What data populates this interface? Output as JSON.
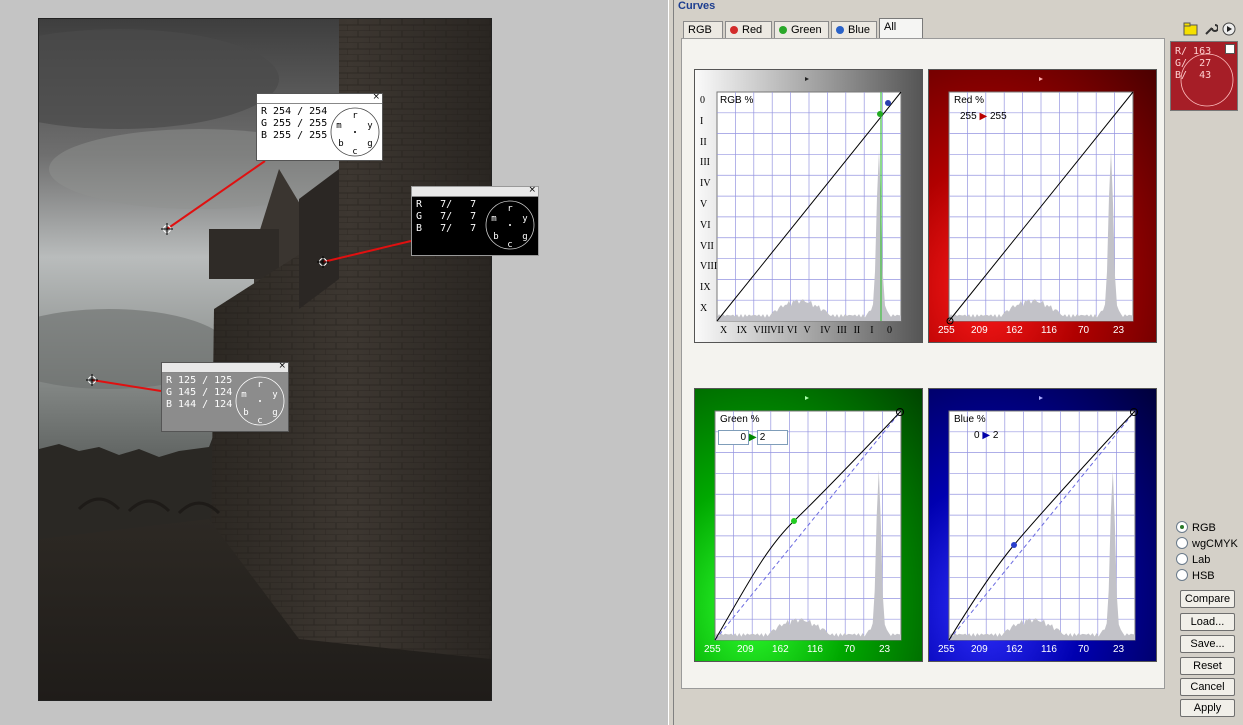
{
  "window": {
    "title": "Curves"
  },
  "tabs": [
    {
      "label": "RGB",
      "dot": null
    },
    {
      "label": "Red",
      "dot": "#d22b2b"
    },
    {
      "label": "Green",
      "dot": "#2aa82a"
    },
    {
      "label": "Blue",
      "dot": "#2a62c8"
    },
    {
      "label": "All",
      "dot": null
    }
  ],
  "active_tab": "All",
  "probes": [
    {
      "r": "R 254 / 254",
      "g": "G 255 / 255",
      "b": "B 255 / 255"
    },
    {
      "r": "R   7/   7",
      "g": "G   7/   7",
      "b": "B   7/   7"
    },
    {
      "r": "R 125 / 125",
      "g": "G 145 / 124",
      "b": "B 144 / 124"
    }
  ],
  "probe_dial_letters": [
    "r",
    "y",
    "g",
    "c",
    "b",
    "m"
  ],
  "probe_close": "×",
  "curves": {
    "rgb": {
      "label": "RGB %",
      "zones_left": [
        "0",
        "I",
        "II",
        "III",
        "IV",
        "V",
        "VI",
        "VII",
        "VIII",
        "IX",
        "X"
      ],
      "zones_bottom": [
        "X",
        "IX",
        "VIII",
        "VII",
        "VI",
        "V",
        "IV",
        "III",
        "II",
        "I",
        "0"
      ]
    },
    "red": {
      "label": "Red %",
      "in": "255",
      "arrow": "▶",
      "out": "255",
      "ticks": [
        "255",
        "209",
        "162",
        "116",
        "70",
        "23"
      ]
    },
    "green": {
      "label": "Green %",
      "in": "0",
      "arrow": "▶",
      "out": "2",
      "ticks": [
        "255",
        "209",
        "162",
        "116",
        "70",
        "23"
      ]
    },
    "blue": {
      "label": "Blue %",
      "in": "0",
      "arrow": "▶",
      "out": "2",
      "ticks": [
        "255",
        "209",
        "162",
        "116",
        "70",
        "23"
      ]
    }
  },
  "swatch": {
    "r": "R/ 163",
    "g": "G/  27",
    "b": "B/  43",
    "color": "#a61e27"
  },
  "color_modes": [
    {
      "label": "RGB",
      "selected": true
    },
    {
      "label": "wgCMYK",
      "selected": false
    },
    {
      "label": "Lab",
      "selected": false
    },
    {
      "label": "HSB",
      "selected": false
    }
  ],
  "buttons": {
    "compare": "Compare",
    "load": "Load...",
    "save": "Save...",
    "reset": "Reset",
    "cancel": "Cancel",
    "apply": "Apply"
  },
  "icons": [
    "folder-icon",
    "wrench-icon",
    "play-icon",
    "expand-icon"
  ]
}
